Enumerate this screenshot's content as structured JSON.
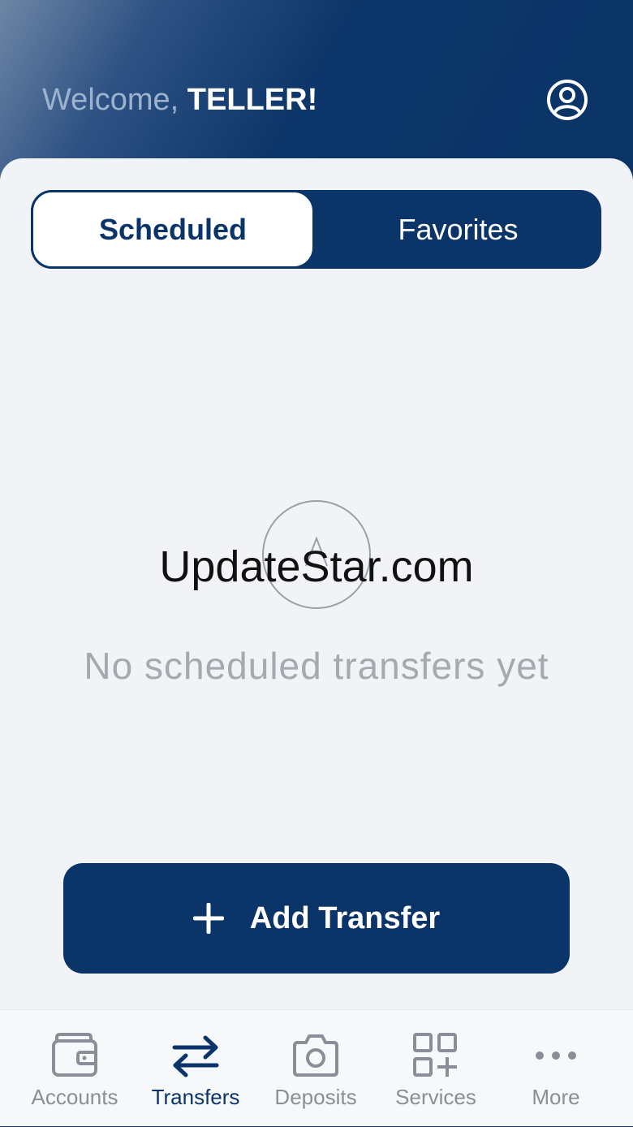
{
  "header": {
    "welcome_prefix": "Welcome, ",
    "user_name": "TELLER!",
    "profile_icon": "user-circle-icon"
  },
  "tabs": [
    {
      "label": "Scheduled",
      "selected": true
    },
    {
      "label": "Favorites",
      "selected": false
    }
  ],
  "empty_state": {
    "icon": "empty-circle-icon",
    "message": "No scheduled transfers yet"
  },
  "watermark": "UpdateStar.com",
  "add_button": {
    "label": "Add Transfer",
    "icon": "plus-icon"
  },
  "bottom_nav": [
    {
      "label": "Accounts",
      "icon": "wallet-icon",
      "active": false
    },
    {
      "label": "Transfers",
      "icon": "transfer-arrows-icon",
      "active": true
    },
    {
      "label": "Deposits",
      "icon": "camera-icon",
      "active": false
    },
    {
      "label": "Services",
      "icon": "grid-plus-icon",
      "active": false
    },
    {
      "label": "More",
      "icon": "more-dots-icon",
      "active": false
    }
  ],
  "colors": {
    "primary": "#0b3468",
    "background": "#f1f3f6",
    "muted_text": "#a5a9b0",
    "nav_inactive": "#8a8f97"
  }
}
